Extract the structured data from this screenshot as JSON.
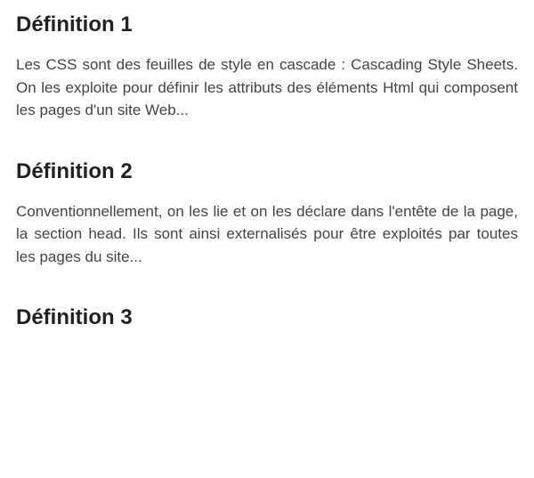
{
  "definitions": [
    {
      "title": "Définition 1",
      "text": "Les CSS sont des feuilles de style en cascade : Cascading Style Sheets. On les exploite pour définir les attributs des éléments Html qui composent les pages d'un site Web..."
    },
    {
      "title": "Définition 2",
      "text": "Conventionnellement, on les lie et on les déclare dans l'entête de la page, la section head. Ils sont ainsi externalisés pour être exploités par toutes les pages du site..."
    },
    {
      "title": "Définition 3",
      "text": ""
    }
  ]
}
